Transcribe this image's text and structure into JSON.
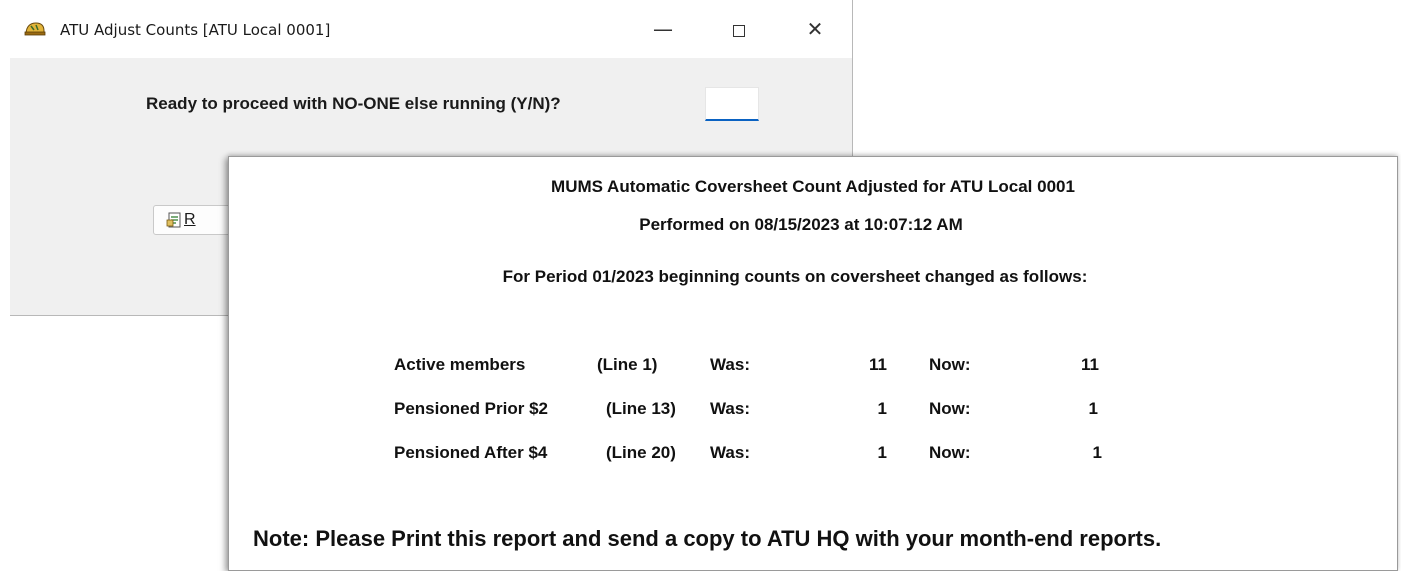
{
  "dialog": {
    "title": "ATU Adjust Counts [ATU Local 0001]",
    "prompt": "Ready to proceed with NO-ONE else running (Y/N)?",
    "input_value": "",
    "report_button_label": "R",
    "window_controls": {
      "minimize": "—",
      "close": "✕"
    }
  },
  "report": {
    "title": "MUMS Automatic Coversheet Count Adjusted for ATU Local 0001",
    "performed": "Performed on 08/15/2023 at 10:07:12 AM",
    "period": "For Period 01/2023 beginning counts on coversheet changed as follows:",
    "rows": [
      {
        "label": "Active members",
        "line": "(Line 1)",
        "was_label": "Was:",
        "was": "11",
        "now_label": "Now:",
        "now": "11"
      },
      {
        "label": "Pensioned Prior $2",
        "line": "(Line 13)",
        "was_label": "Was:",
        "was": "1",
        "now_label": "Now:",
        "now": "1"
      },
      {
        "label": "Pensioned After $4",
        "line": "(Line 20)",
        "was_label": "Was:",
        "was": "1",
        "now_label": "Now:",
        "now": "1"
      }
    ],
    "note": "Note: Please Print this report and send a copy to ATU HQ with your month-end reports."
  },
  "colors": {
    "input_underline": "#0a62c2",
    "dialog_bg": "#f0f0f0"
  },
  "icons": {
    "app": "helmet-icon",
    "report_button": "report-icon"
  }
}
